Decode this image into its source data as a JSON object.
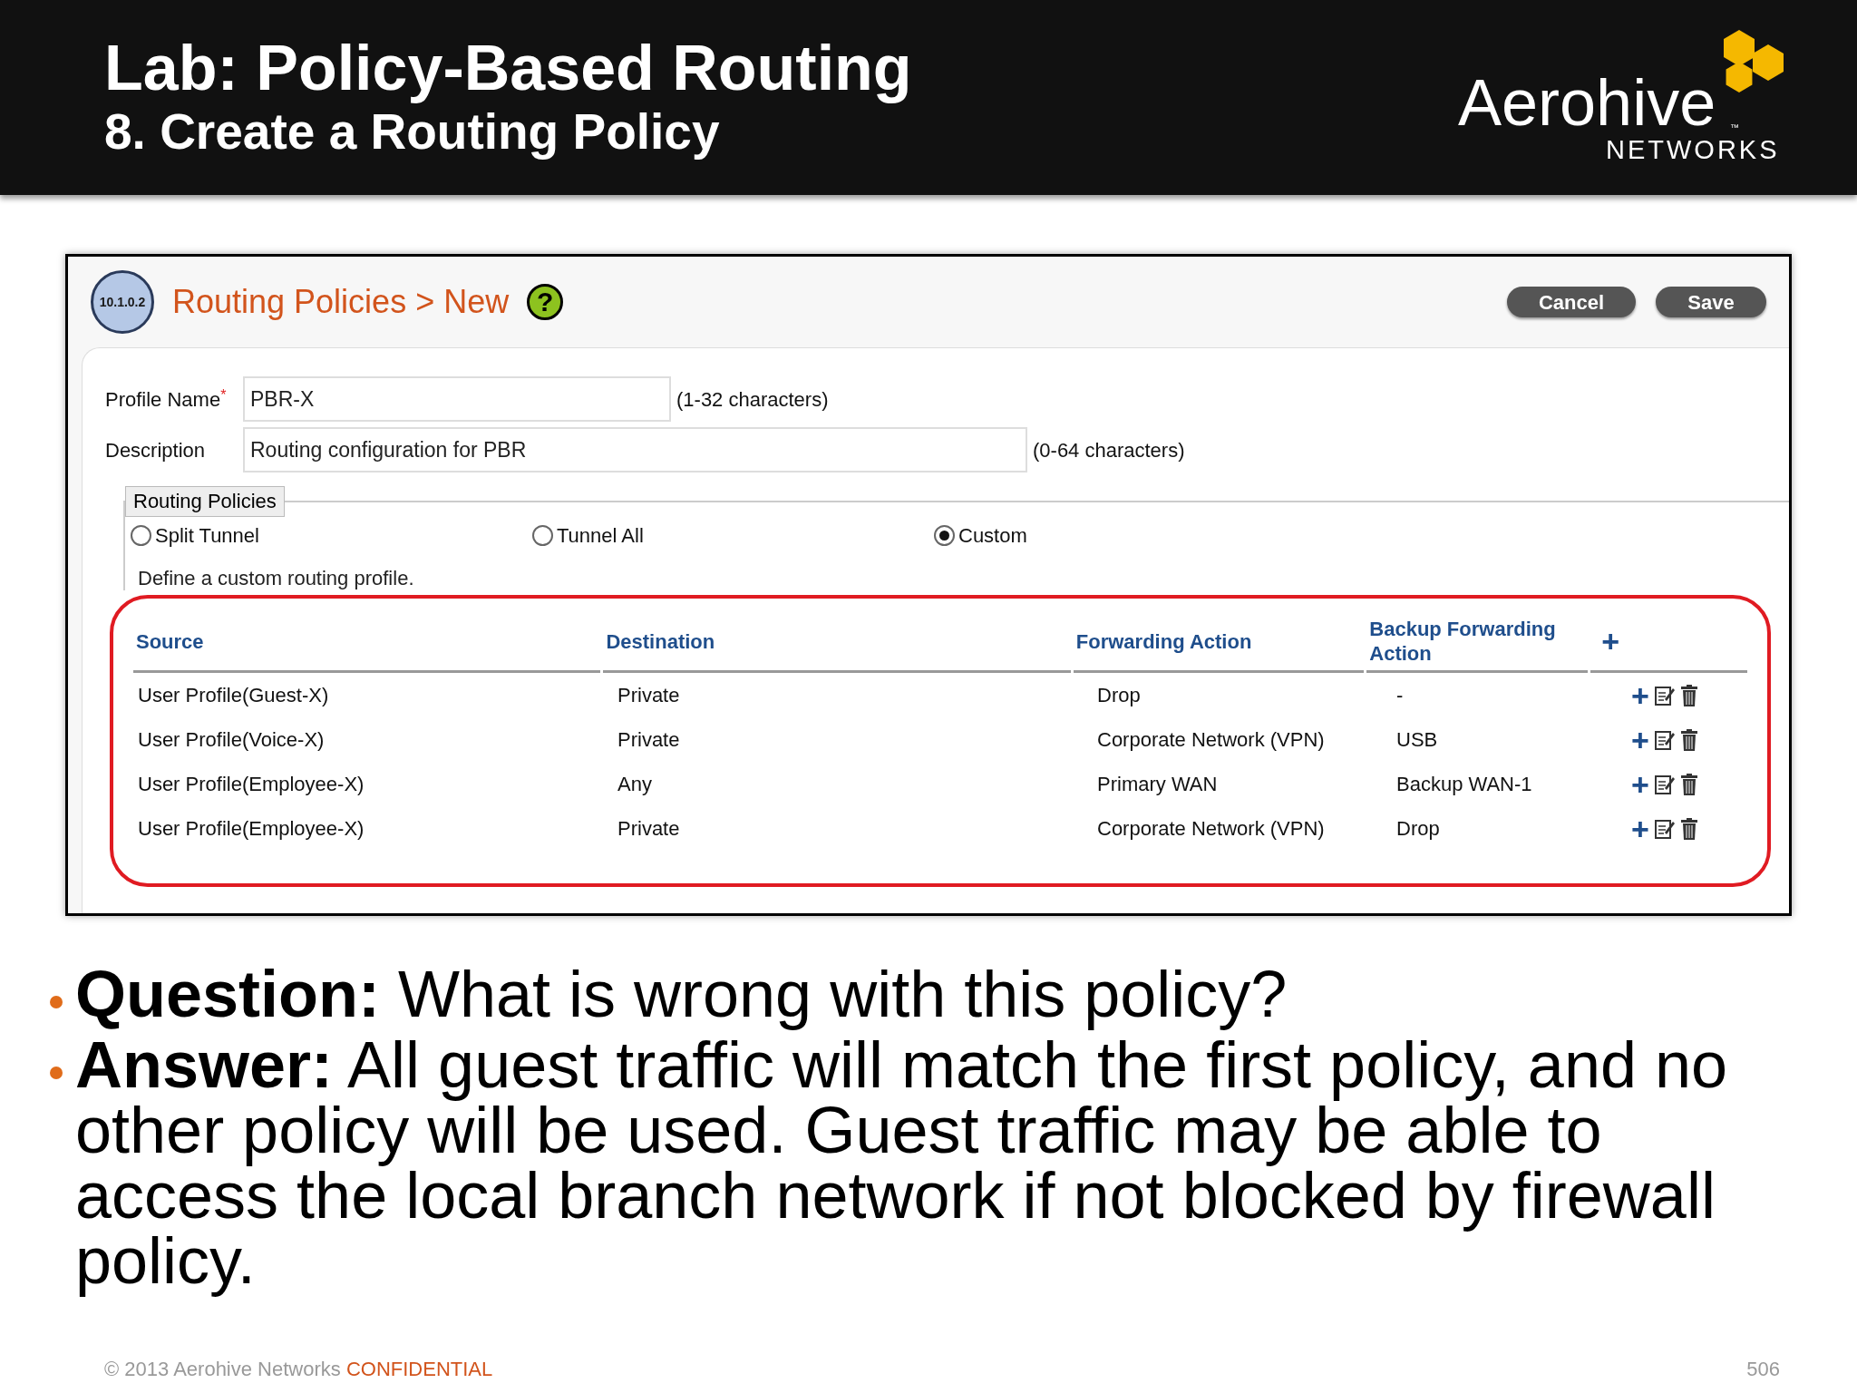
{
  "slide": {
    "title": "Lab: Policy-Based Routing",
    "subtitle": "8. Create a Routing Policy",
    "logo": {
      "wordmark": "Aerohive",
      "tm": "™",
      "tagline": "NETWORKS"
    }
  },
  "app": {
    "version_badge": "10.1.0.2",
    "breadcrumb": "Routing Policies > New",
    "help": "?",
    "buttons": [
      "Cancel",
      "Save"
    ],
    "fields": [
      {
        "label": "Profile Name",
        "required_mark": "*",
        "value": "PBR-X",
        "hint": "(1-32 characters)",
        "kind": "short"
      },
      {
        "label": "Description",
        "value": "Routing configuration for PBR",
        "hint": "(0-64 characters)",
        "kind": "long"
      }
    ],
    "routing_policies": {
      "legend": "Routing Policies",
      "options": [
        {
          "label": "Split Tunnel",
          "selected": false
        },
        {
          "label": "Tunnel All",
          "selected": false
        },
        {
          "label": "Custom",
          "selected": true
        }
      ],
      "note": "Define a custom routing profile."
    },
    "table": {
      "columns": [
        "Source",
        "Destination",
        "Forwarding Action",
        "Backup Forwarding Action"
      ],
      "add_icon": "+",
      "rows": [
        [
          "User Profile(Guest-X)",
          "Private",
          "Drop",
          "-"
        ],
        [
          "User Profile(Voice-X)",
          "Private",
          "Corporate Network (VPN)",
          "USB"
        ],
        [
          "User Profile(Employee-X)",
          "Any",
          "Primary WAN",
          "Backup WAN-1"
        ],
        [
          "User Profile(Employee-X)",
          "Private",
          "Corporate Network (VPN)",
          "Drop"
        ]
      ]
    }
  },
  "bullets": [
    {
      "lead": "Question:",
      "text": "What is wrong with this policy?"
    },
    {
      "lead": "Answer:",
      "text": "All guest traffic will match the first policy, and no other policy will be used. Guest traffic may be able to access the local branch network if not blocked by firewall policy."
    }
  ],
  "footer": {
    "copyright": "© 2013 Aerohive Networks",
    "confidential": "CONFIDENTIAL",
    "page": "506"
  }
}
